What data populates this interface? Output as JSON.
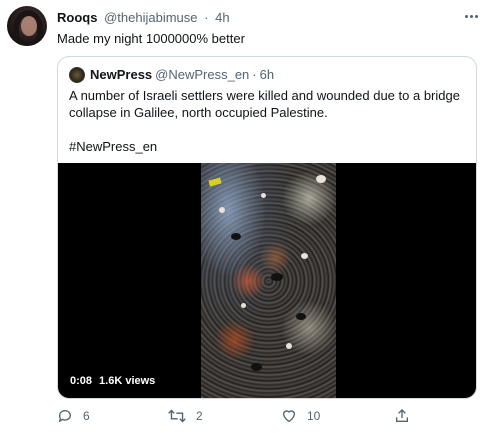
{
  "tweet": {
    "author_name": "Rooqs",
    "author_handle": "@thehijabimuse",
    "separator": "·",
    "time": "4h",
    "text": "Made my night 1000000% better"
  },
  "quote": {
    "author_name": "NewPress",
    "author_handle": "@NewPress_en",
    "separator": "·",
    "time": "6h",
    "text": "A number of Israeli settlers were killed and wounded due to a bridge collapse in Galilee, north occupied Palestine.",
    "hashtag": "#NewPress_en",
    "video": {
      "elapsed": "0:08",
      "views": "1.6K views"
    }
  },
  "actions": {
    "reply_count": "6",
    "retweet_count": "2",
    "like_count": "10"
  },
  "icons": {
    "more": "more-icon",
    "reply": "reply-icon",
    "retweet": "retweet-icon",
    "like": "heart-icon",
    "share": "share-icon"
  },
  "colors": {
    "text": "#0f1419",
    "secondary": "#536471",
    "border": "#cfd9de",
    "video_bg": "#000000"
  }
}
